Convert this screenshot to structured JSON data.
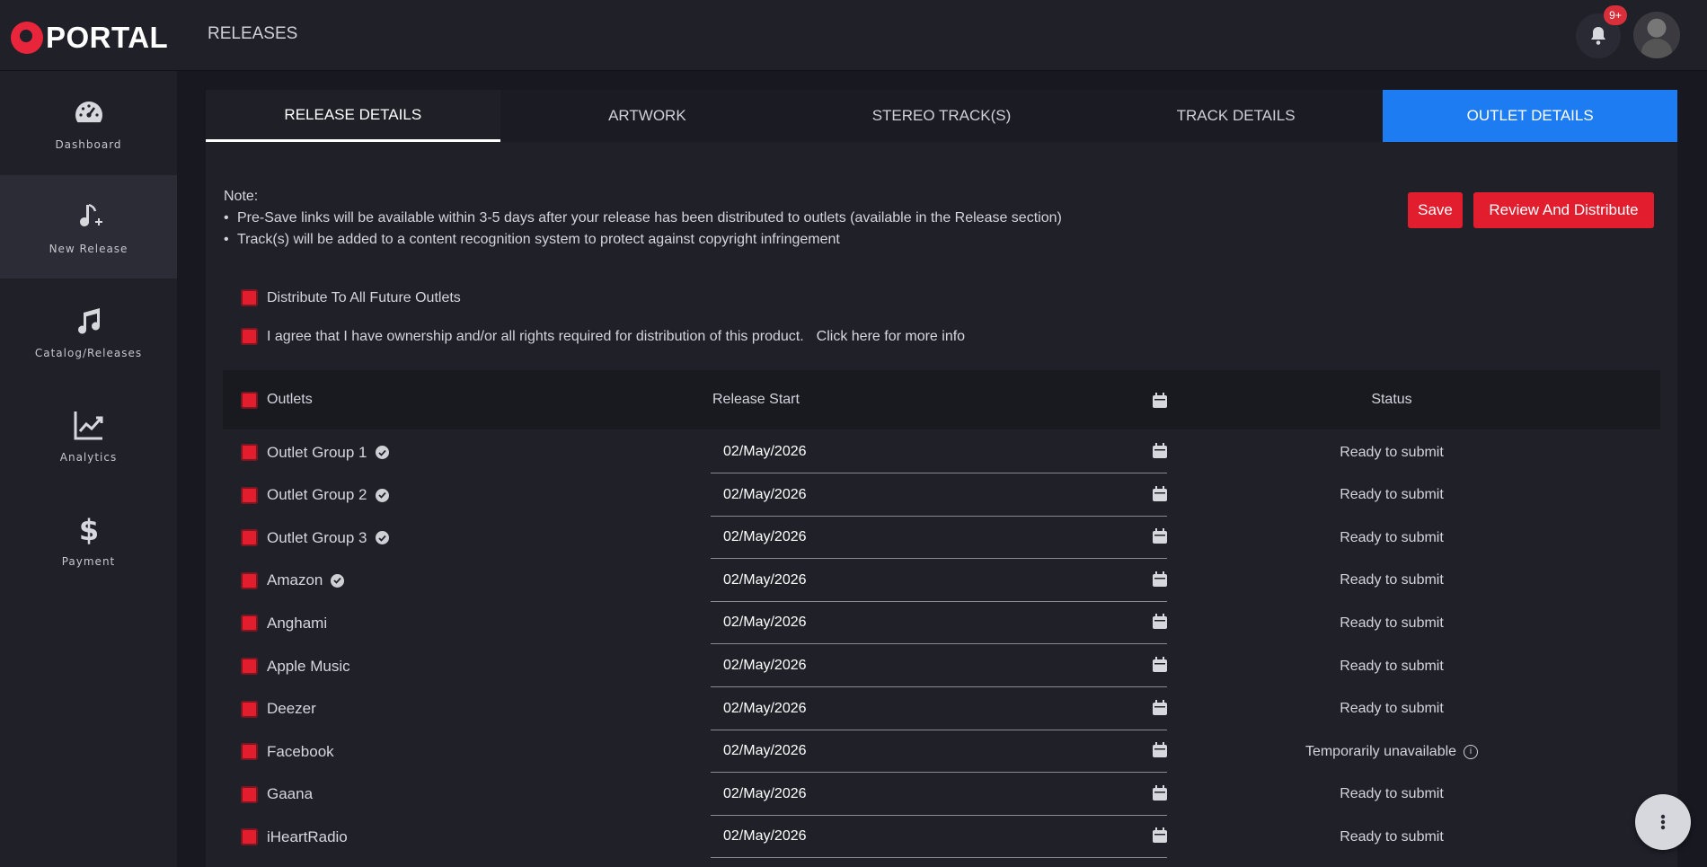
{
  "app": {
    "logo_text": "PORTAL",
    "page_title": "RELEASES"
  },
  "notifications": {
    "badge": "9+"
  },
  "sidebar": {
    "items": [
      {
        "label": "Dashboard",
        "icon": "dashboard-gauge-icon"
      },
      {
        "label": "New Release",
        "icon": "music-note-plus-icon",
        "active": true
      },
      {
        "label": "Catalog/Releases",
        "icon": "music-notes-icon"
      },
      {
        "label": "Analytics",
        "icon": "chart-line-icon"
      },
      {
        "label": "Payment",
        "icon": "dollar-icon"
      }
    ]
  },
  "tabs": [
    {
      "label": "RELEASE DETAILS"
    },
    {
      "label": "ARTWORK"
    },
    {
      "label": "STEREO TRACK(S)"
    },
    {
      "label": "TRACK DETAILS"
    },
    {
      "label": "OUTLET DETAILS"
    }
  ],
  "note": {
    "heading": "Note:",
    "items": [
      "Pre-Save links will be available within 3-5 days after your release has been distributed to outlets (available in the Release section)",
      "Track(s) will be added to a content recognition system to protect against copyright infringement"
    ]
  },
  "actions": {
    "save": "Save",
    "review": "Review And Distribute"
  },
  "options": {
    "distribute_future": "Distribute To All Future Outlets",
    "agree": "I agree that I have ownership and/or all rights required for distribution of this product.",
    "more_info": "Click here for more info"
  },
  "table": {
    "headers": {
      "outlets": "Outlets",
      "release_start": "Release Start",
      "status": "Status"
    },
    "rows": [
      {
        "name": "Outlet Group 1",
        "date": "02/May/2026",
        "status": "Ready to submit"
      },
      {
        "name": "Outlet Group 2",
        "date": "02/May/2026",
        "status": "Ready to submit"
      },
      {
        "name": "Outlet Group 3",
        "date": "02/May/2026",
        "status": "Ready to submit"
      },
      {
        "name": "Amazon",
        "date": "02/May/2026",
        "status": "Ready to submit"
      },
      {
        "name": "Anghami",
        "date": "02/May/2026",
        "status": "Ready to submit"
      },
      {
        "name": "Apple Music",
        "date": "02/May/2026",
        "status": "Ready to submit"
      },
      {
        "name": "Deezer",
        "date": "02/May/2026",
        "status": "Ready to submit"
      },
      {
        "name": "Facebook",
        "date": "02/May/2026",
        "status": "Temporarily unavailable"
      },
      {
        "name": "Gaana",
        "date": "02/May/2026",
        "status": "Ready to submit"
      },
      {
        "name": "iHeartRadio",
        "date": "02/May/2026",
        "status": "Ready to submit"
      }
    ]
  },
  "colors": {
    "accent_red": "#e11d2e",
    "accent_blue": "#1e7cf2",
    "background": "#181820"
  }
}
